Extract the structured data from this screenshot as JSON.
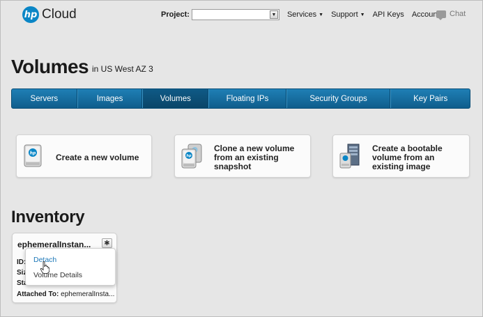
{
  "header": {
    "logo_badge": "hp",
    "logo_text": "Cloud",
    "project_label": "Project:",
    "project_value": "",
    "nav": [
      {
        "label": "Services",
        "has_caret": true
      },
      {
        "label": "Support",
        "has_caret": true
      },
      {
        "label": "API Keys",
        "has_caret": false
      },
      {
        "label": "Account",
        "has_caret": true
      }
    ],
    "chat_label": "Chat"
  },
  "page": {
    "title": "Volumes",
    "subtitle": "in US West AZ 3"
  },
  "tabs": [
    {
      "label": "Servers",
      "active": false
    },
    {
      "label": "Images",
      "active": false
    },
    {
      "label": "Volumes",
      "active": true
    },
    {
      "label": "Floating IPs",
      "active": false
    },
    {
      "label": "Security Groups",
      "active": false
    },
    {
      "label": "Key Pairs",
      "active": false
    }
  ],
  "actions": [
    {
      "label_lines": [
        "Create a new volume"
      ],
      "icon": "volume-disk-icon"
    },
    {
      "label_lines": [
        "Clone a new volume",
        "from an existing",
        "snapshot"
      ],
      "icon": "clone-snapshot-icon"
    },
    {
      "label_lines": [
        "Create a bootable",
        "volume from an",
        "existing image"
      ],
      "icon": "bootable-image-icon"
    }
  ],
  "inventory": {
    "title": "Inventory",
    "volume": {
      "name": "ephemeralInstan...",
      "id_label": "ID:",
      "size_label": "Size:",
      "status_label": "Status:",
      "attached_label": "Attached To:",
      "attached_value": "ephemeralInsta..."
    },
    "menu": {
      "items": [
        "Detach",
        "Volume Details"
      ]
    }
  },
  "colors": {
    "accent": "#0a86c6",
    "tab_bar": "#156a9c",
    "tab_active": "#0c4f78",
    "link": "#1d78b8",
    "background": "#e6e6e6"
  }
}
